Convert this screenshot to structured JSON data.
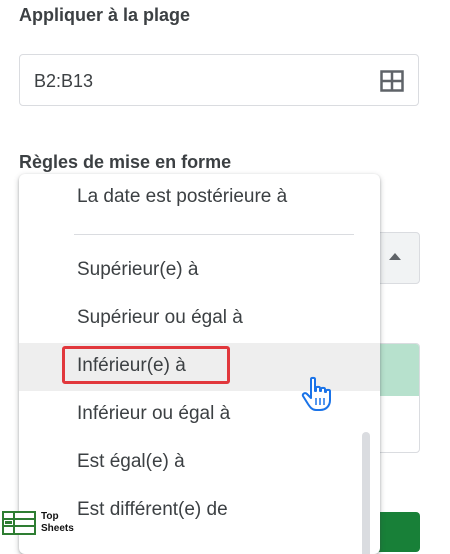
{
  "apply_range": {
    "title": "Appliquer à la plage",
    "value": "B2:B13",
    "icon": "grid-select-icon"
  },
  "rules": {
    "title": "Règles de mise en forme"
  },
  "menu": {
    "items": [
      {
        "label": "La date est postérieure à"
      },
      {
        "label": "Supérieur(e) à"
      },
      {
        "label": "Supérieur ou égal à"
      },
      {
        "label": "Inférieur(e) à",
        "highlighted": true,
        "hovered": true
      },
      {
        "label": "Inférieur ou égal à"
      },
      {
        "label": "Est égal(e) à"
      },
      {
        "label": "Est différent(e) de"
      }
    ]
  },
  "colors": {
    "highlight_outline": "#e1373c",
    "preview_green": "#b7e1cd",
    "button_green": "#188038"
  },
  "watermark": {
    "line1": "Top",
    "line2": "Sheets",
    "icon": "sheets-logo-icon"
  }
}
